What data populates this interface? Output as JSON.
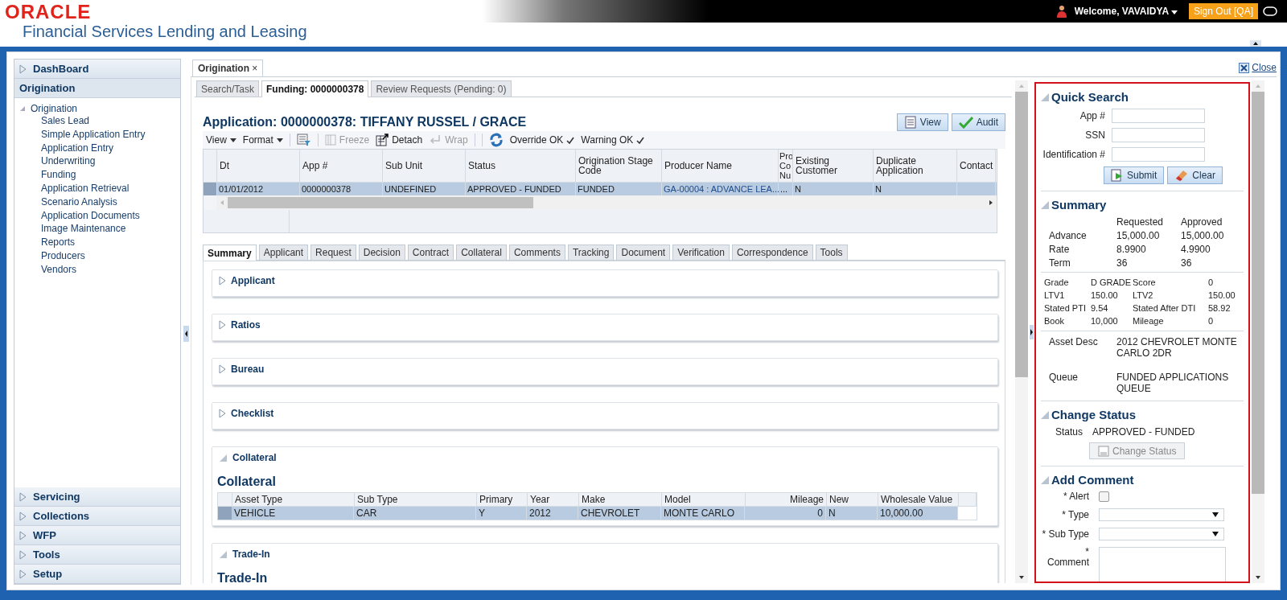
{
  "header": {
    "logo": "ORACLE",
    "product": "Financial Services Lending and Leasing",
    "welcome": "Welcome, VAVAIDYA",
    "sign_out": "Sign Out [QA]"
  },
  "nav": [
    {
      "label": "DashBoard",
      "expanded": false,
      "selected": false
    },
    {
      "label": "Origination",
      "expanded": true,
      "selected": true,
      "tree": {
        "label": "Origination",
        "expanded": true,
        "children": [
          {
            "label": "Sales Lead"
          },
          {
            "label": "Simple Application Entry"
          },
          {
            "label": "Application Entry"
          },
          {
            "label": "Underwriting"
          },
          {
            "label": "Funding"
          },
          {
            "label": "Application Retrieval"
          },
          {
            "label": "Scenario Analysis"
          },
          {
            "label": "Application Documents"
          },
          {
            "label": "Image Maintenance"
          },
          {
            "label": "Reports"
          },
          {
            "label": "Producers"
          },
          {
            "label": "Vendors"
          }
        ]
      }
    },
    {
      "label": "Servicing",
      "expanded": false,
      "selected": false
    },
    {
      "label": "Collections",
      "expanded": false,
      "selected": false
    },
    {
      "label": "WFP",
      "expanded": false,
      "selected": false
    },
    {
      "label": "Tools",
      "expanded": false,
      "selected": false
    },
    {
      "label": "Setup",
      "expanded": false,
      "selected": false
    }
  ],
  "workspace": {
    "tab": {
      "label": "Origination",
      "close": "×"
    },
    "close_link": "Close"
  },
  "subtabs": [
    {
      "label": "Search/Task",
      "selected": false
    },
    {
      "label": "Funding: 0000000378",
      "selected": true
    },
    {
      "label": "Review Requests (Pending: 0)",
      "selected": false
    }
  ],
  "application": {
    "title": "Application: 0000000378: TIFFANY RUSSEL / GRACE",
    "buttons": [
      {
        "label": "View",
        "kind": "view"
      },
      {
        "label": "Audit",
        "kind": "audit"
      }
    ],
    "toolbar": [
      {
        "kind": "menu",
        "label": "View",
        "disabled": false
      },
      {
        "kind": "menu",
        "label": "Format",
        "disabled": false
      },
      {
        "kind": "filter",
        "disabled": false
      },
      {
        "kind": "freeze",
        "label": "Freeze",
        "disabled": true
      },
      {
        "kind": "detach",
        "label": "Detach",
        "disabled": false
      },
      {
        "kind": "wrap",
        "label": "Wrap",
        "disabled": true
      },
      {
        "kind": "refresh",
        "disabled": false
      },
      {
        "kind": "check",
        "label": "Override OK",
        "disabled": false
      },
      {
        "kind": "check",
        "label": "Warning OK",
        "disabled": false
      }
    ],
    "grid": {
      "columns": [
        "Dt",
        "App #",
        "Sub Unit",
        "Status",
        "Origination Stage Code",
        "Producer Name",
        "Pro Co Nu",
        "Existing Customer",
        "Duplicate Application",
        "Contact"
      ],
      "rows": [
        {
          "selected": true,
          "cells": [
            "01/01/2012",
            "0000000378",
            "UNDEFINED",
            "APPROVED - FUNDED",
            "FUNDED",
            "GA-00004 : ADVANCE LEA...",
            "...",
            "N",
            "N",
            ""
          ]
        }
      ]
    }
  },
  "detail_tabs": [
    {
      "label": "Summary",
      "selected": true
    },
    {
      "label": "Applicant",
      "selected": false
    },
    {
      "label": "Request",
      "selected": false
    },
    {
      "label": "Decision",
      "selected": false
    },
    {
      "label": "Contract",
      "selected": false
    },
    {
      "label": "Collateral",
      "selected": false
    },
    {
      "label": "Comments",
      "selected": false
    },
    {
      "label": "Tracking",
      "selected": false
    },
    {
      "label": "Document",
      "selected": false
    },
    {
      "label": "Verification",
      "selected": false
    },
    {
      "label": "Correspondence",
      "selected": false
    },
    {
      "label": "Tools",
      "selected": false
    }
  ],
  "sections": [
    {
      "title": "Applicant",
      "expanded": false
    },
    {
      "title": "Ratios",
      "expanded": false
    },
    {
      "title": "Bureau",
      "expanded": false
    },
    {
      "title": "Checklist",
      "expanded": false
    },
    {
      "title": "Collateral",
      "expanded": true,
      "heading": "Collateral",
      "table": {
        "columns": [
          "Asset Type",
          "Sub Type",
          "Primary",
          "Year",
          "Make",
          "Model",
          "Mileage",
          "New",
          "Wholesale Value"
        ],
        "rows": [
          {
            "selected": true,
            "cells": [
              "VEHICLE",
              "CAR",
              "Y",
              "2012",
              "CHEVROLET",
              "MONTE CARLO",
              "0",
              "N",
              "10,000.00"
            ]
          }
        ]
      }
    },
    {
      "title": "Trade-In",
      "expanded": true,
      "heading": "Trade-In"
    }
  ],
  "quick_search": {
    "title": "Quick Search",
    "fields": [
      {
        "label": "App #"
      },
      {
        "label": "SSN"
      },
      {
        "label": "Identification #"
      }
    ],
    "buttons": [
      {
        "label": "Submit",
        "kind": "submit"
      },
      {
        "label": "Clear",
        "kind": "clear"
      }
    ]
  },
  "summary": {
    "title": "Summary",
    "headers": [
      "Requested",
      "Approved"
    ],
    "amounts": [
      {
        "label": "Advance",
        "requested": "15,000.00",
        "approved": "15,000.00"
      },
      {
        "label": "Rate",
        "requested": "8.9900",
        "approved": "4.9900"
      },
      {
        "label": "Term",
        "requested": "36",
        "approved": "36"
      }
    ],
    "metrics": [
      {
        "label": "Grade",
        "value": "D GRADE",
        "label2": "Score",
        "value2": "0"
      },
      {
        "label": "LTV1",
        "value": "150.00",
        "label2": "LTV2",
        "value2": "150.00"
      },
      {
        "label": "Stated PTI",
        "value": "9.54",
        "label2": "Stated After DTI",
        "value2": "58.92"
      },
      {
        "label": "Book",
        "value": "10,000",
        "label2": "Mileage",
        "value2": "0"
      }
    ],
    "details": [
      {
        "label": "Asset Desc",
        "value": "2012 CHEVROLET MONTE CARLO 2DR"
      },
      {
        "label": "Queue",
        "value": "FUNDED APPLICATIONS QUEUE"
      }
    ]
  },
  "change_status": {
    "title": "Change Status",
    "label": "Status",
    "value": "APPROVED - FUNDED",
    "button": {
      "label": "Change Status",
      "disabled": true
    }
  },
  "add_comment": {
    "title": "Add Comment",
    "fields": [
      {
        "kind": "checkbox",
        "label": "* Alert",
        "checked": false
      },
      {
        "kind": "select",
        "label": "* Type"
      },
      {
        "kind": "select",
        "label": "* Sub Type"
      },
      {
        "kind": "textarea",
        "label": "* Comment"
      }
    ]
  }
}
